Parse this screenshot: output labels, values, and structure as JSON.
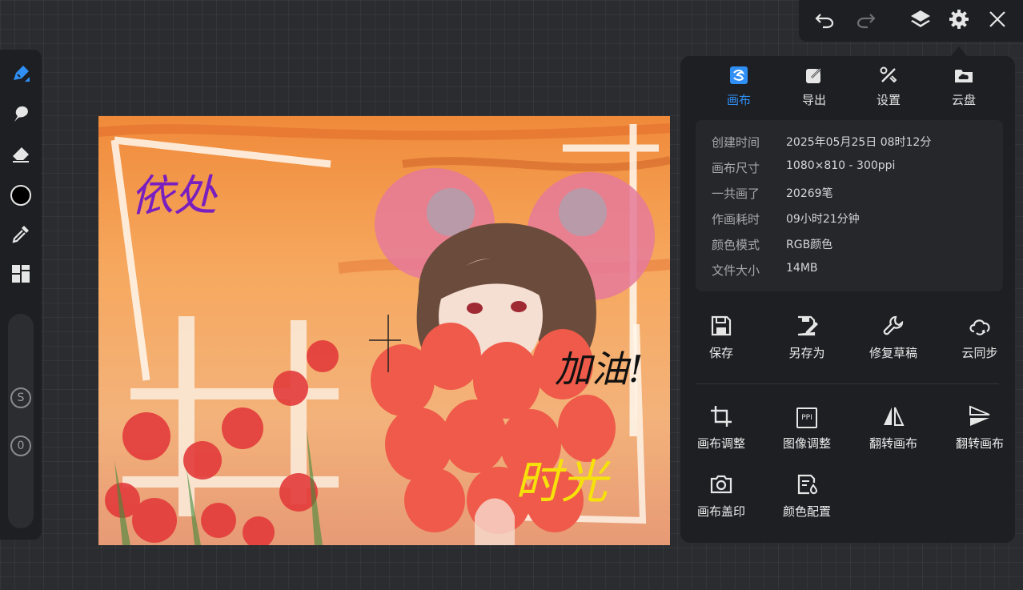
{
  "top_toolbar": {
    "undo_icon": "undo-icon",
    "redo_icon": "redo-icon",
    "layers_icon": "layers-icon",
    "settings_icon": "gear-icon",
    "close_icon": "close-icon"
  },
  "left_toolbar": {
    "tools": [
      "brush",
      "smudge",
      "eraser",
      "color",
      "eyedropper",
      "gallery"
    ],
    "active_tool": "brush",
    "accent_color": "#2f8ff5",
    "current_color": "#000000",
    "size_badge": "S",
    "opacity_badge": "0"
  },
  "artwork": {
    "signature_top_left": "依处",
    "signature_right": "加油!",
    "signature_bottom": "时光"
  },
  "panel": {
    "tabs": [
      {
        "label": "画布",
        "icon": "canvas-icon",
        "active": true
      },
      {
        "label": "导出",
        "icon": "export-icon",
        "active": false
      },
      {
        "label": "设置",
        "icon": "tools-icon",
        "active": false
      },
      {
        "label": "云盘",
        "icon": "cloud-drive-icon",
        "active": false
      }
    ],
    "info": [
      {
        "key": "创建时间",
        "value": "2025年05月25日 08时12分"
      },
      {
        "key": "画布尺寸",
        "value": "1080×810 - 300ppi"
      },
      {
        "key": "一共画了",
        "value": "20269笔"
      },
      {
        "key": "作画耗时",
        "value": "09小时21分钟"
      },
      {
        "key": "颜色模式",
        "value": "RGB颜色"
      },
      {
        "key": "文件大小",
        "value": "14MB"
      }
    ],
    "file_actions": [
      {
        "label": "保存",
        "icon": "save-icon"
      },
      {
        "label": "另存为",
        "icon": "save-as-icon"
      },
      {
        "label": "修复草稿",
        "icon": "wrench-icon"
      },
      {
        "label": "云同步",
        "icon": "cloud-sync-icon"
      }
    ],
    "canvas_actions": [
      {
        "label": "画布调整",
        "icon": "crop-icon"
      },
      {
        "label": "图像调整",
        "icon": "ppi-icon",
        "icon_text": "PPI"
      },
      {
        "label": "翻转画布",
        "icon": "flip-horizontal-icon"
      },
      {
        "label": "翻转画布",
        "icon": "flip-vertical-icon"
      },
      {
        "label": "画布盖印",
        "icon": "camera-icon"
      },
      {
        "label": "颜色配置",
        "icon": "color-config-icon"
      }
    ]
  }
}
